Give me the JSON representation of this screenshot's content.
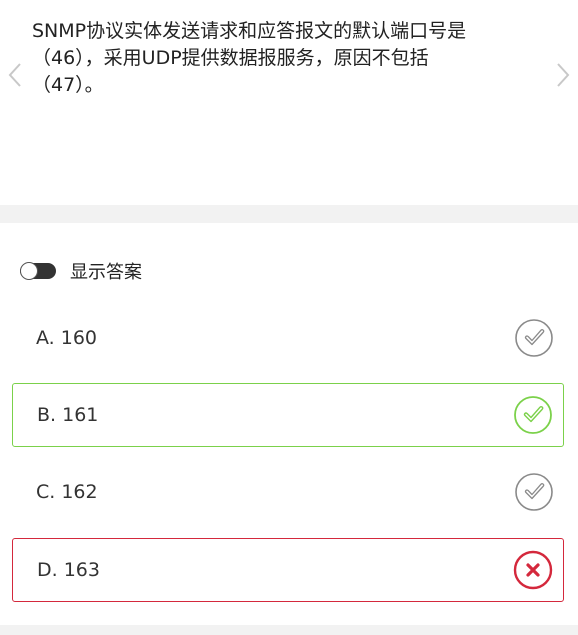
{
  "question": {
    "lines": [
      "SNMP协议实体发送请求和应答报文的默认端口号是",
      "（46），采用UDP提供数据报服务，原因不包括",
      "（47）。"
    ]
  },
  "answer_toggle": {
    "label": "显示答案",
    "enabled": false
  },
  "options": [
    {
      "label": "A. 160",
      "state": "neutral"
    },
    {
      "label": "B. 161",
      "state": "correct"
    },
    {
      "label": "C. 162",
      "state": "neutral"
    },
    {
      "label": "D. 163",
      "state": "wrong"
    }
  ],
  "colors": {
    "correct": "#7bd14a",
    "wrong": "#d4283c",
    "neutral_icon": "#8a8a8a",
    "band": "#f2f2f2"
  },
  "icons": {
    "prev": "chevron-left-icon",
    "next": "chevron-right-icon",
    "check": "check-circle-icon",
    "wrong": "x-circle-icon"
  }
}
